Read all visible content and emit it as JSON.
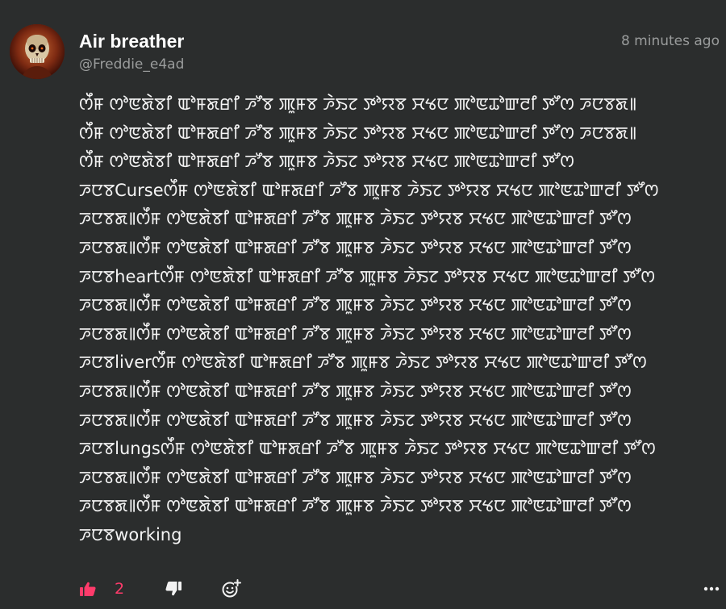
{
  "post": {
    "username": "Air breather",
    "handle": "@Freddie_e4ad",
    "timestamp": "8 minutes ago",
    "lines": [
      "ꯁꯩꯝ ꯁꯣꯟꯗꯥꯕꯤ ꯑꯣꯝꯗꯔꯤ ꯍꯧꯕ ꯄꯨꯝꯕ ꯍꯥꯏꯖ ꯇꯣꯌꯕ ꯆꯠꯅ ꯄꯣꯟꯊꯣꯛꯂꯤ ꯇꯧꯁ ꯍꯅꯕꯗ꯫",
      "ꯁꯩꯝ ꯁꯣꯟꯗꯥꯕꯤ ꯑꯣꯝꯗꯔꯤ ꯍꯧꯕ ꯄꯨꯝꯕ ꯍꯥꯏꯖ ꯇꯣꯌꯕ ꯆꯠꯅ ꯄꯣꯟꯊꯣꯛꯂꯤ ꯇꯧꯁ ꯍꯅꯕꯗ꯫",
      "ꯁꯩꯝ ꯁꯣꯟꯗꯥꯕꯤ ꯑꯣꯝꯗꯔꯤ ꯍꯧꯕ ꯄꯨꯝꯕ ꯍꯥꯏꯖ ꯇꯣꯌꯕ ꯆꯠꯅ ꯄꯣꯟꯊꯣꯛꯂꯤ ꯇꯧꯁ",
      "ꯍꯅꯕCurseꯁꯩꯝ ꯁꯣꯟꯗꯥꯕꯤ ꯑꯣꯝꯗꯔꯤ ꯍꯧꯕ ꯄꯨꯝꯕ ꯍꯥꯏꯖ ꯇꯣꯌꯕ ꯆꯠꯅ ꯄꯣꯟꯊꯣꯛꯂꯤ ꯇꯧꯁ",
      "ꯍꯅꯕꯗ꯫ꯁꯩꯝ ꯁꯣꯟꯗꯥꯕꯤ ꯑꯣꯝꯗꯔꯤ ꯍꯧꯕ ꯄꯨꯝꯕ ꯍꯥꯏꯖ ꯇꯣꯌꯕ ꯆꯠꯅ ꯄꯣꯟꯊꯣꯛꯂꯤ ꯇꯧꯁ",
      "ꯍꯅꯕꯗ꯫ꯁꯩꯝ ꯁꯣꯟꯗꯥꯕꯤ ꯑꯣꯝꯗꯔꯤ ꯍꯧꯕ ꯄꯨꯝꯕ ꯍꯥꯏꯖ ꯇꯣꯌꯕ ꯆꯠꯅ ꯄꯣꯟꯊꯣꯛꯂꯤ ꯇꯧꯁ",
      "ꯍꯅꯕheartꯁꯩꯝ ꯁꯣꯟꯗꯥꯕꯤ ꯑꯣꯝꯗꯔꯤ ꯍꯧꯕ ꯄꯨꯝꯕ ꯍꯥꯏꯖ ꯇꯣꯌꯕ ꯆꯠꯅ ꯄꯣꯟꯊꯣꯛꯂꯤ ꯇꯧꯁ",
      "ꯍꯅꯕꯗ꯫ꯁꯩꯝ ꯁꯣꯟꯗꯥꯕꯤ ꯑꯣꯝꯗꯔꯤ ꯍꯧꯕ ꯄꯨꯝꯕ ꯍꯥꯏꯖ ꯇꯣꯌꯕ ꯆꯠꯅ ꯄꯣꯟꯊꯣꯛꯂꯤ ꯇꯧꯁ",
      "ꯍꯅꯕꯗ꯫ꯁꯩꯝ ꯁꯣꯟꯗꯥꯕꯤ ꯑꯣꯝꯗꯔꯤ ꯍꯧꯕ ꯄꯨꯝꯕ ꯍꯥꯏꯖ ꯇꯣꯌꯕ ꯆꯠꯅ ꯄꯣꯟꯊꯣꯛꯂꯤ ꯇꯧꯁ",
      "ꯍꯅꯕliverꯁꯩꯝ ꯁꯣꯟꯗꯥꯕꯤ ꯑꯣꯝꯗꯔꯤ ꯍꯧꯕ ꯄꯨꯝꯕ ꯍꯥꯏꯖ ꯇꯣꯌꯕ ꯆꯠꯅ ꯄꯣꯟꯊꯣꯛꯂꯤ ꯇꯧꯁ",
      "ꯍꯅꯕꯗ꯫ꯁꯩꯝ ꯁꯣꯟꯗꯥꯕꯤ ꯑꯣꯝꯗꯔꯤ ꯍꯧꯕ ꯄꯨꯝꯕ ꯍꯥꯏꯖ ꯇꯣꯌꯕ ꯆꯠꯅ ꯄꯣꯟꯊꯣꯛꯂꯤ ꯇꯧꯁ",
      "ꯍꯅꯕꯗ꯫ꯁꯩꯝ ꯁꯣꯟꯗꯥꯕꯤ ꯑꯣꯝꯗꯔꯤ ꯍꯧꯕ ꯄꯨꯝꯕ ꯍꯥꯏꯖ ꯇꯣꯌꯕ ꯆꯠꯅ ꯄꯣꯟꯊꯣꯛꯂꯤ ꯇꯧꯁ",
      "ꯍꯅꯕlungsꯁꯩꯝ ꯁꯣꯟꯗꯥꯕꯤ ꯑꯣꯝꯗꯔꯤ ꯍꯧꯕ ꯄꯨꯝꯕ ꯍꯥꯏꯖ ꯇꯣꯌꯕ ꯆꯠꯅ ꯄꯣꯟꯊꯣꯛꯂꯤ ꯇꯧꯁ",
      "ꯍꯅꯕꯗ꯫ꯁꯩꯝ ꯁꯣꯟꯗꯥꯕꯤ ꯑꯣꯝꯗꯔꯤ ꯍꯧꯕ ꯄꯨꯝꯕ ꯍꯥꯏꯖ ꯇꯣꯌꯕ ꯆꯠꯅ ꯄꯣꯟꯊꯣꯛꯂꯤ ꯇꯧꯁ",
      "ꯍꯅꯕꯗ꯫ꯁꯩꯝ ꯁꯣꯟꯗꯥꯕꯤ ꯑꯣꯝꯗꯔꯤ ꯍꯧꯕ ꯄꯨꯝꯕ ꯍꯥꯏꯖ ꯇꯣꯌꯕ ꯆꯠꯅ ꯄꯣꯟꯊꯣꯛꯂꯤ ꯇꯧꯁ",
      "ꯍꯅꯕworking"
    ]
  },
  "actions": {
    "like_icon": "thumbs-up-icon",
    "like_count": "2",
    "dislike_icon": "thumbs-down-icon",
    "react_icon": "add-reaction-icon",
    "more_icon": "more-options-icon"
  },
  "colors": {
    "background": "#2b2d2d",
    "text": "#f4f4f4",
    "muted": "#9a9c9c",
    "accent": "#ff3b6b"
  }
}
